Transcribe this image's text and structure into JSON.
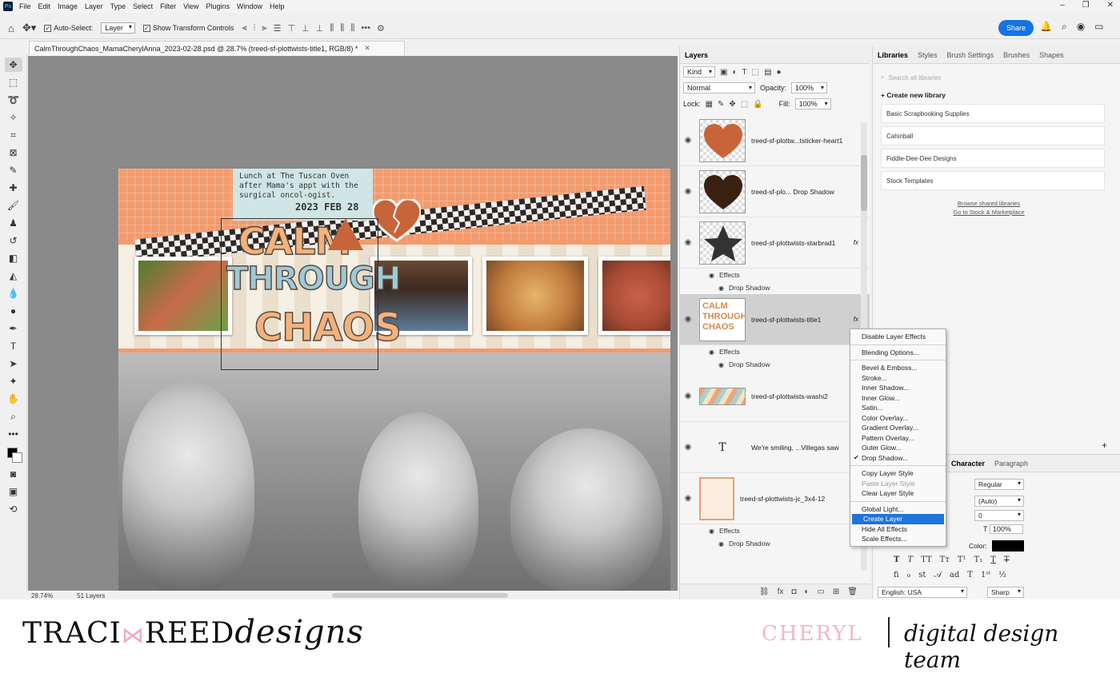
{
  "menu": {
    "items": [
      "File",
      "Edit",
      "Image",
      "Layer",
      "Type",
      "Select",
      "Filter",
      "View",
      "Plugins",
      "Window",
      "Help"
    ]
  },
  "options": {
    "auto_select_label": "Auto-Select:",
    "auto_select_value": "Layer",
    "show_transform_label": "Show Transform Controls",
    "share_label": "Share"
  },
  "document": {
    "tab_title": "CalmThroughChaos_MamaCherylAnna_2023-02-28.psd @ 28.7% (treed-sf-plottwists-title1, RGB/8) *",
    "note_text": "Lunch at The Tuscan Oven after Mama's appt with the surgical oncol-ogist.",
    "note_date": "2023 FEB 28",
    "title_line1": "CALM",
    "title_line2": "THROUGH",
    "title_line3": "CHAOS"
  },
  "layers_panel": {
    "tabs": [
      "Layers"
    ],
    "filter_kind": "Kind",
    "blend_mode": "Normal",
    "opacity_label": "Opacity:",
    "opacity_value": "100%",
    "lock_label": "Lock:",
    "fill_label": "Fill:",
    "fill_value": "100%",
    "layers": [
      {
        "name": "treed-sf-plottw...tsticker-heart1"
      },
      {
        "name": "treed-sf-plo... Drop Shadow"
      },
      {
        "name": "treed-sf-plottwists-starbrad1"
      },
      {
        "name": "treed-sf-plottwists-title1"
      },
      {
        "name": "treed-sf-plottwists-washi2"
      },
      {
        "name": "We're smiling, ...Villegas saw"
      },
      {
        "name": "treed-sf-plottwists-jc_3x4-12"
      }
    ],
    "effects_label": "Effects",
    "drop_shadow_label": "Drop Shadow",
    "fx_label": "fx"
  },
  "libraries_panel": {
    "tabs": [
      "Libraries",
      "Styles",
      "Brush Settings",
      "Brushes",
      "Shapes"
    ],
    "search_placeholder": "Search all libraries",
    "create_label": "Create new library",
    "items": [
      "Basic Scrapbooking Supplies",
      "Cahinball",
      "Fiddle-Dee-Dee Designs",
      "Stock Templates"
    ],
    "browse_link": "Browse shared libraries",
    "stock_link": "Go to Stock & Marketplace"
  },
  "character_panel": {
    "tabs": [
      "Character",
      "Paragraph"
    ],
    "font_style": "Regular",
    "leading": "(Auto)",
    "tracking": "0",
    "vscale": "100%",
    "color_label": "Color:",
    "color_value": "#000000",
    "language": "English: USA",
    "antialias": "Sharp"
  },
  "context_menu": {
    "groups": [
      [
        "Disable Layer Effects"
      ],
      [
        "Blending Options..."
      ],
      [
        "Bevel & Emboss...",
        "Stroke...",
        "Inner Shadow...",
        "Inner Glow...",
        "Satin...",
        "Color Overlay...",
        "Gradient Overlay...",
        "Pattern Overlay...",
        "Outer Glow...",
        "Drop Shadow..."
      ],
      [
        "Copy Layer Style",
        "Paste Layer Style",
        "Clear Layer Style"
      ],
      [
        "Global Light...",
        "Create Layer",
        "Hide All Effects",
        "Scale Effects..."
      ]
    ],
    "checked": "Drop Shadow...",
    "disabled": "Paste Layer Style",
    "highlighted": "Create Layer"
  },
  "status": {
    "zoom": "28.74%",
    "layers_count": "51 Layers"
  },
  "brand": {
    "left_a": "TRACI",
    "left_b": "REED",
    "left_script": "designs",
    "name": "CHERYL",
    "team": "digital design team"
  },
  "colors": {
    "accent": "#1473e6",
    "highlight": "#1e74d8",
    "brand_pink": "#f3b6cd",
    "canvas_bg": "#8a8a8a"
  }
}
